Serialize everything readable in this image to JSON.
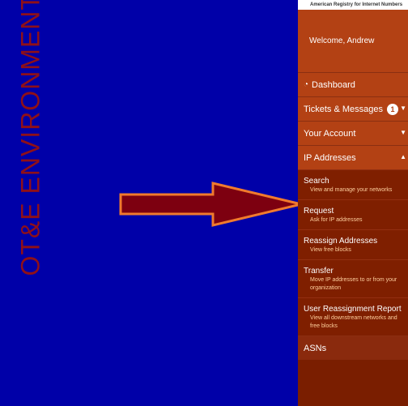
{
  "left": {
    "vertical_text": "OT&E ENVIRONMENT"
  },
  "header": {
    "registry": "American Registry for Internet Numbers"
  },
  "welcome": {
    "text": "Welcome, Andrew"
  },
  "nav": {
    "dashboard": "Dashboard",
    "tickets": "Tickets & Messages",
    "tickets_badge": "1",
    "account": "Your Account",
    "ip_addresses": "IP Addresses",
    "asns": "ASNs"
  },
  "submenu": {
    "items": [
      {
        "title": "Search",
        "desc": "View and manage your networks"
      },
      {
        "title": "Request",
        "desc": "Ask for IP addresses"
      },
      {
        "title": "Reassign Addresses",
        "desc": "View free blocks"
      },
      {
        "title": "Transfer",
        "desc": "Move IP addresses to or from your organization"
      },
      {
        "title": "User Reassignment Report",
        "desc": "View all downstream networks and free blocks"
      }
    ]
  },
  "colors": {
    "left_bg": "#0000a8",
    "sidebar_bg": "#b34114",
    "submenu_bg": "#7f1f00",
    "arrow_fill": "#7d0010",
    "arrow_stroke": "#f07a2d"
  },
  "icons": {
    "dashboard": "gauge-icon",
    "chevron": "chevron-icon",
    "arrow": "arrow-right-icon"
  }
}
